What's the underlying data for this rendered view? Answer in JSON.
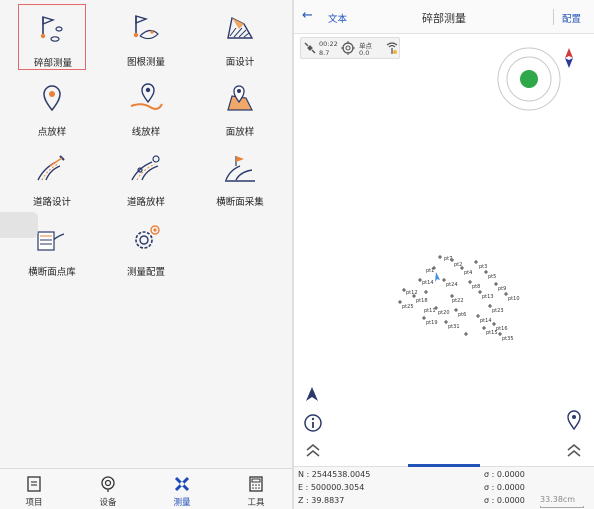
{
  "menu": {
    "items": [
      {
        "label": "碎部测量",
        "icon": "flag-point-survey-icon",
        "selected": true
      },
      {
        "label": "图根测量",
        "icon": "flag-traverse-survey-icon"
      },
      {
        "label": "面设计",
        "icon": "area-design-icon"
      },
      {
        "label": "点放样",
        "icon": "point-stakeout-icon"
      },
      {
        "label": "线放样",
        "icon": "line-stakeout-icon"
      },
      {
        "label": "面放样",
        "icon": "area-stakeout-icon"
      },
      {
        "label": "道路设计",
        "icon": "road-design-icon"
      },
      {
        "label": "道路放样",
        "icon": "road-stakeout-icon"
      },
      {
        "label": "横断面采集",
        "icon": "cross-section-collect-icon"
      },
      {
        "label": "横断面点库",
        "icon": "cross-section-library-icon"
      },
      {
        "label": "测量配置",
        "icon": "survey-config-gear-icon"
      }
    ]
  },
  "bottom_nav": [
    {
      "label": "项目",
      "icon": "project-icon"
    },
    {
      "label": "设备",
      "icon": "device-icon"
    },
    {
      "label": "测量",
      "icon": "survey-icon",
      "active": true
    },
    {
      "label": "工具",
      "icon": "tools-icon"
    }
  ],
  "survey_screen": {
    "back_icon": "arrow-left-icon",
    "text_button": "文本",
    "title": "碎部测量",
    "config_button": "配置",
    "status": {
      "sat_top": "00:22",
      "sat_bottom": "8.7",
      "mode_top": "单点",
      "mode_bottom": "0.0"
    },
    "points": [
      "pt7",
      "pt2",
      "pt3",
      "pt1",
      "pt4",
      "pt5",
      "pt14",
      "pt24",
      "pt8",
      "pt9",
      "pt10",
      "pt12",
      "pt18",
      "pt13",
      "pt22",
      "pt25",
      "pt20",
      "pt23",
      "pt11",
      "pt6",
      "pt19",
      "pt31",
      "pt14",
      "pt16",
      "pt15",
      "pt35"
    ],
    "coords": {
      "n": "N : 2544538.0045",
      "e": "E : 500000.3054",
      "z": "Z : 39.8837",
      "s1": "σ : 0.0000",
      "s2": "σ : 0.0000",
      "s3": "σ : 0.0000"
    },
    "scale": "33.38cm",
    "accent_color": "#2253b8",
    "fix_color": "#2ea84a"
  }
}
